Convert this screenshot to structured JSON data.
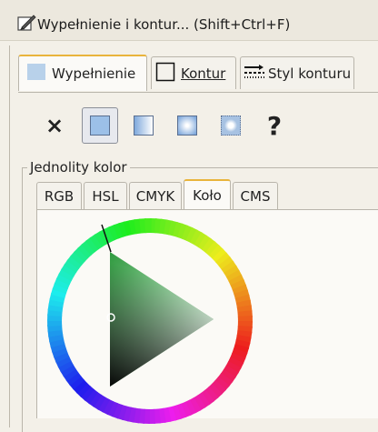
{
  "window": {
    "title": "Wypełnienie i kontur... (Shift+Ctrl+F)",
    "title_icon": "brush-icon"
  },
  "tabs": [
    {
      "label": "Wypełnienie",
      "icon": "fill-icon",
      "active": true
    },
    {
      "label": "Kontur",
      "icon": "stroke-paint-icon",
      "active": false
    },
    {
      "label": "Styl konturu",
      "icon": "stroke-style-icon",
      "active": false
    }
  ],
  "fill_types": [
    {
      "name": "no-paint",
      "glyph": "×"
    },
    {
      "name": "flat-color",
      "selected": true
    },
    {
      "name": "linear-gradient"
    },
    {
      "name": "radial-gradient"
    },
    {
      "name": "pattern"
    },
    {
      "name": "unset",
      "glyph": "?"
    }
  ],
  "group": {
    "label": "Jednolity kolor"
  },
  "color_tabs": [
    {
      "label": "RGB",
      "active": false
    },
    {
      "label": "HSL",
      "active": false
    },
    {
      "label": "CMYK",
      "active": false
    },
    {
      "label": "Koło",
      "active": true
    },
    {
      "label": "CMS",
      "active": false
    }
  ],
  "colors": {
    "accent_tab": "#e9b43c",
    "selected_hue": "#2e9a3e"
  }
}
